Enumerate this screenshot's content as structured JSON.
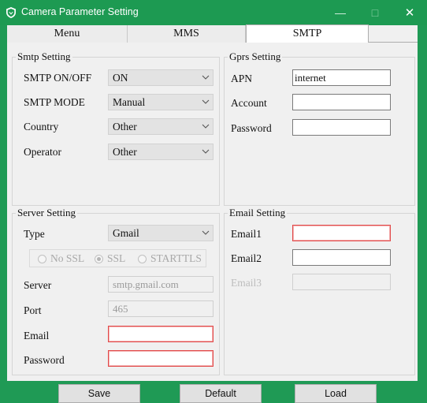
{
  "window": {
    "title": "Camera Parameter Setting",
    "min_glyph": "—",
    "max_glyph": "□",
    "close_glyph": "✕"
  },
  "tabs": [
    {
      "label": "Menu"
    },
    {
      "label": "MMS"
    },
    {
      "label": "SMTP",
      "selected": true
    }
  ],
  "smtp_setting": {
    "title": "Smtp Setting",
    "onoff_label": "SMTP ON/OFF",
    "onoff_value": "ON",
    "mode_label": "SMTP MODE",
    "mode_value": "Manual",
    "country_label": "Country",
    "country_value": "Other",
    "operator_label": "Operator",
    "operator_value": "Other"
  },
  "gprs_setting": {
    "title": "Gprs Setting",
    "apn_label": "APN",
    "apn_value": "internet",
    "account_label": "Account",
    "account_value": "",
    "password_label": "Password",
    "password_value": ""
  },
  "server_setting": {
    "title": "Server Setting",
    "type_label": "Type",
    "type_value": "Gmail",
    "ssl_options": [
      "No SSL",
      "SSL",
      "STARTTLS"
    ],
    "ssl_selected": "SSL",
    "server_label": "Server",
    "server_value": "smtp.gmail.com",
    "port_label": "Port",
    "port_value": "465",
    "email_label": "Email",
    "email_value": "",
    "password_label": "Password",
    "password_value": ""
  },
  "email_setting": {
    "title": "Email Setting",
    "email1_label": "Email1",
    "email1_value": "",
    "email2_label": "Email2",
    "email2_value": "",
    "email3_label": "Email3",
    "email3_value": ""
  },
  "buttons": {
    "save": "Save",
    "default": "Default",
    "load": "Load"
  },
  "colors": {
    "titlebar": "#1d9a52",
    "required_border": "#e24a4a"
  }
}
